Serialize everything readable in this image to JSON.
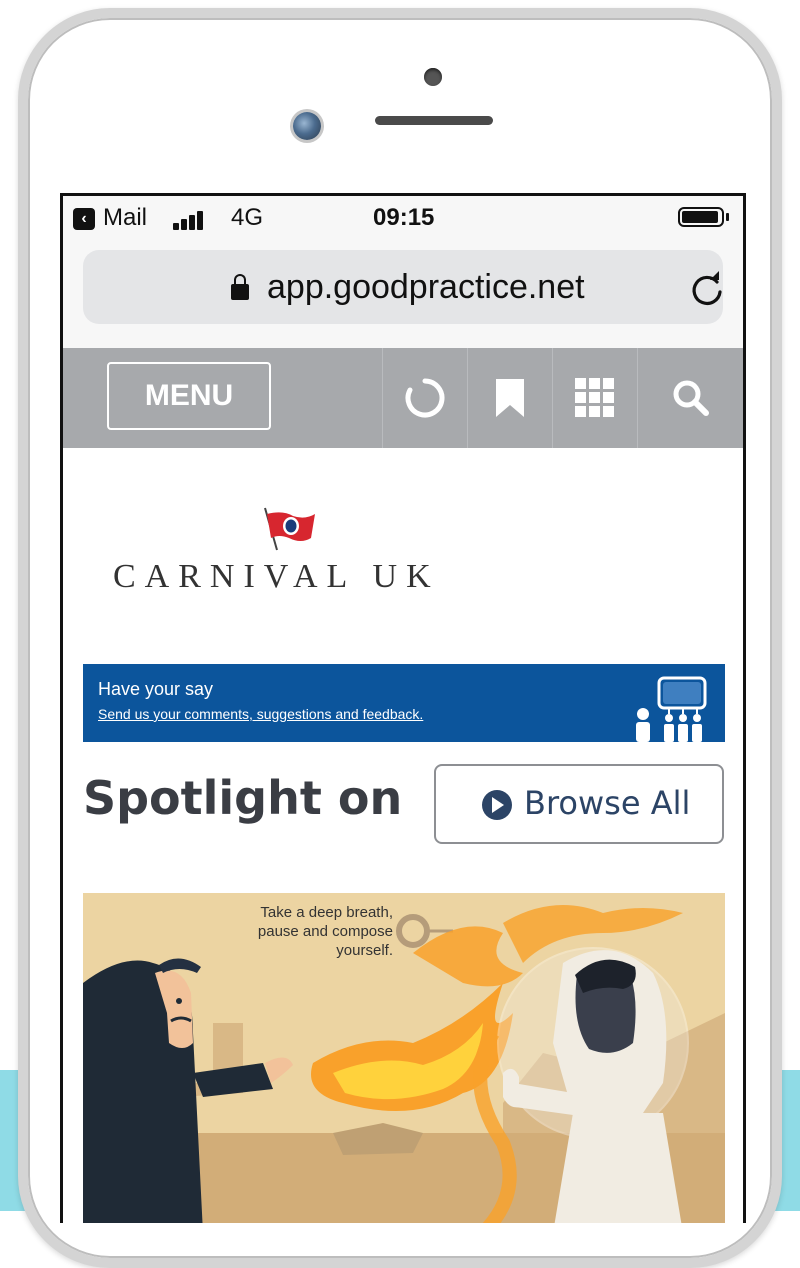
{
  "status_bar": {
    "back_label": "Mail",
    "network": "4G",
    "time": "09:15"
  },
  "browser": {
    "url": "app.goodpractice.net"
  },
  "toolbar": {
    "menu_label": "MENU",
    "icons": [
      "loading-icon",
      "bookmark-icon",
      "grid-icon",
      "search-icon"
    ]
  },
  "logo": {
    "text": "CARNIVAL UK"
  },
  "banner": {
    "title": "Have your say",
    "link": "Send us your comments, suggestions and feedback."
  },
  "spotlight": {
    "title": "Spotlight on",
    "browse_label": "Browse All"
  },
  "hero": {
    "caption": "Take a deep breath, pause and compose yourself."
  },
  "colors": {
    "toolbar_bg": "#a7a9ac",
    "banner_bg": "#0c559c",
    "browse_text": "#2c4466",
    "page_bg_accent": "#8fdbe6"
  }
}
